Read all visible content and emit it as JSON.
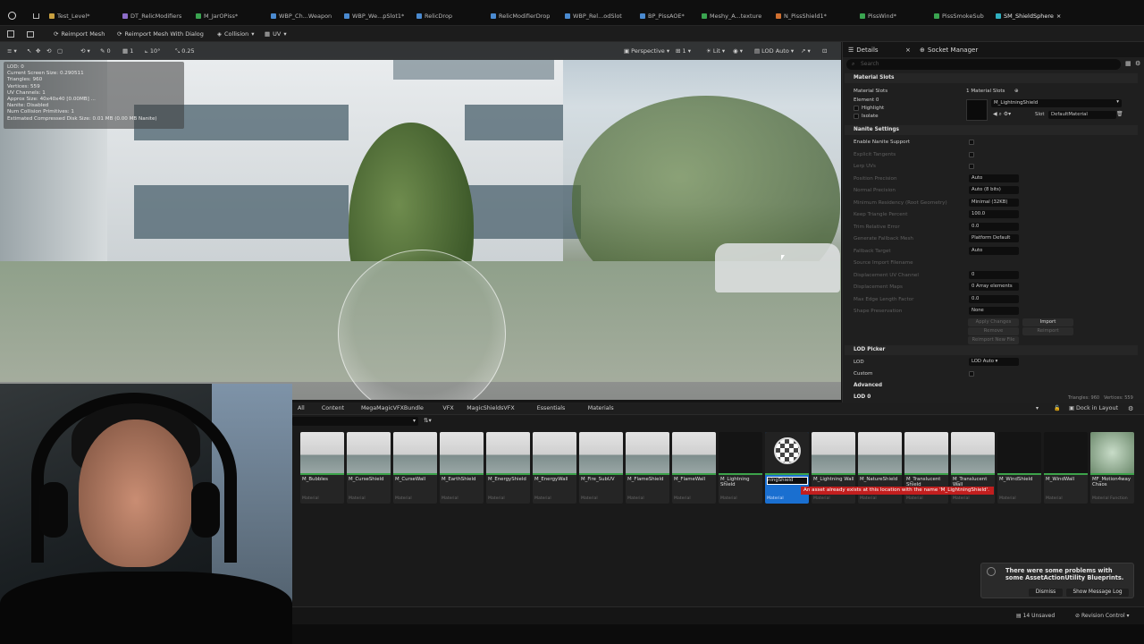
{
  "tabs": [
    {
      "label": "Test_Level*",
      "color": "#c8a040"
    },
    {
      "label": "DT_RelicModifiers",
      "color": "#8c6cc8"
    },
    {
      "label": "M_JarOPiss*",
      "color": "#3aa450"
    },
    {
      "label": "WBP_Ch...Weapon",
      "color": "#4a8ad0"
    },
    {
      "label": "WBP_We...pSlot1*",
      "color": "#4a8ad0"
    },
    {
      "label": "RelicDrop",
      "color": "#4a8ad0"
    },
    {
      "label": "RelicModifierDrop",
      "color": "#4a8ad0"
    },
    {
      "label": "WBP_Rel...odSlot",
      "color": "#4a8ad0"
    },
    {
      "label": "BP_PissAOE*",
      "color": "#4a8ad0"
    },
    {
      "label": "Meshy_A...texture",
      "color": "#3aa450"
    },
    {
      "label": "N_PissShield1*",
      "color": "#d07030"
    },
    {
      "label": "PissWind*",
      "color": "#3aa450"
    },
    {
      "label": "PissSmokeSub",
      "color": "#3aa450"
    },
    {
      "label": "SM_ShieldSphere",
      "color": "#30b0c0"
    }
  ],
  "toolbar": {
    "reimport": "Reimport Mesh",
    "reimport_dialog": "Reimport Mesh With Dialog",
    "collision": "Collision",
    "uv": "UV"
  },
  "viewport": {
    "snap_rot": "10°",
    "snap_scale": "0.25",
    "perspective": "Perspective",
    "lit": "Lit",
    "lod": "LOD Auto",
    "stats": [
      "LOD:  0",
      "Current Screen Size:  0.290511",
      "Triangles:  960",
      "Vertices:  559",
      "UV Channels:  1",
      "Approx Size: 40x40x40 [0.00MB] ...",
      "Nanite:  Disabled",
      "Num Collision Primitives:  1",
      "Estimated Compressed Disk Size: 0.01 MB (0.00 MB Nanite)"
    ]
  },
  "details": {
    "tab": "Details",
    "tab2": "Socket Manager",
    "search_placeholder": "Search",
    "sections": {
      "material_slots": "Material Slots",
      "nanite": "Nanite Settings",
      "lod_picker": "LOD Picker",
      "advanced": "Advanced",
      "lod0": "LOD 0"
    },
    "material_slots_label": "Material Slots",
    "material_slots_value": "1 Material Slots",
    "element": "Element 0",
    "highlight": "Highlight",
    "isolate": "Isolate",
    "material": "M_LightningShield",
    "slot_label": "Slot",
    "slot_value": "DefaultMaterial",
    "nanite_rows": [
      {
        "label": "Enable Nanite Support",
        "value": ""
      },
      {
        "label": "Explicit Tangents",
        "value": ""
      },
      {
        "label": "Lerp UVs",
        "value": ""
      },
      {
        "label": "Position Precision",
        "value": "Auto"
      },
      {
        "label": "Normal Precision",
        "value": "Auto (8 bits)"
      },
      {
        "label": "Minimum Residency (Root Geometry)",
        "value": "Minimal (32KB)"
      },
      {
        "label": "Keep Triangle Percent",
        "value": "100.0"
      },
      {
        "label": "Trim Relative Error",
        "value": "0.0"
      },
      {
        "label": "Generate Fallback Mesh",
        "value": "Platform Default"
      },
      {
        "label": "Fallback Target",
        "value": "Auto"
      },
      {
        "label": "Source Import Filename",
        "value": ""
      },
      {
        "label": "Displacement UV Channel",
        "value": "0"
      },
      {
        "label": "Displacement Maps",
        "value": "0 Array elements"
      },
      {
        "label": "Max Edge Length Factor",
        "value": "0.0"
      },
      {
        "label": "Shape Preservation",
        "value": "None"
      }
    ],
    "apply": "Apply Changes",
    "import": "Import",
    "remove": "Remove",
    "reimport": "Reimport",
    "reimport_file": "Reimport New File",
    "lod_label": "LOD",
    "lod_value": "LOD Auto",
    "custom": "Custom",
    "tri_count": "Triangles: 960",
    "vert_count": "Vertices: 559"
  },
  "content_browser": {
    "path": [
      "All",
      "Content",
      "MegaMagicVFXBundle",
      "VFX",
      "MagicShieldsVFX",
      "Essentials",
      "Materials"
    ],
    "dock": "Dock in Layout",
    "assets": [
      {
        "name": "M_Bubbles",
        "type": "Material",
        "dark": false
      },
      {
        "name": "M_CurseShield",
        "type": "Material",
        "dark": false
      },
      {
        "name": "M_CurseWall",
        "type": "Material",
        "dark": false
      },
      {
        "name": "M_EarthShield",
        "type": "Material",
        "dark": false
      },
      {
        "name": "M_EnergyShield",
        "type": "Material",
        "dark": false
      },
      {
        "name": "M_EnergyWall",
        "type": "Material",
        "dark": false
      },
      {
        "name": "M_Fire_SubUV",
        "type": "Material",
        "dark": false
      },
      {
        "name": "M_FlameShield",
        "type": "Material",
        "dark": false
      },
      {
        "name": "M_FlameWall",
        "type": "Material",
        "dark": false
      },
      {
        "name": "M_Lightning Shield",
        "type": "Material",
        "dark": true
      },
      {
        "name": "ningShield",
        "type": "Material",
        "dark": false,
        "selected": true
      },
      {
        "name": "M_Lightning Wall",
        "type": "Material",
        "dark": false
      },
      {
        "name": "M_NatureShield",
        "type": "Material",
        "dark": false
      },
      {
        "name": "M_Translucent Shield",
        "type": "Material",
        "dark": false
      },
      {
        "name": "M_Translucent Wall",
        "type": "Material",
        "dark": false
      },
      {
        "name": "M_WindShield",
        "type": "Material",
        "dark": true
      },
      {
        "name": "M_WindWall",
        "type": "Material",
        "dark": true
      },
      {
        "name": "MF_Motion4way Chaos",
        "type": "Material Function",
        "dark": false
      }
    ],
    "error": "An asset already exists at this location with the name 'M_LightningShield'.",
    "toast_title": "There were some problems with some AssetActionUtility Blueprints.",
    "dismiss": "Dismiss",
    "show_log": "Show Message Log",
    "unsaved": "14 Unsaved",
    "revision": "Revision Control"
  }
}
